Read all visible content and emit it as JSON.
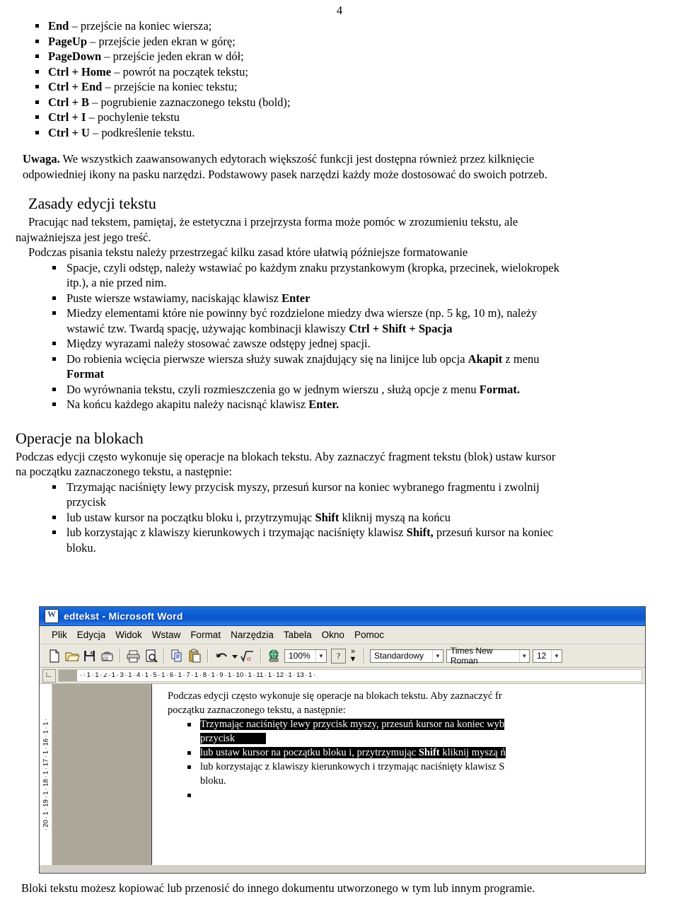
{
  "page": {
    "number": "4"
  },
  "shortcut_list": [
    {
      "key": "End",
      "desc": " – przejście na koniec wiersza;"
    },
    {
      "key": "PageUp",
      "desc": " – przejście jeden ekran w górę;"
    },
    {
      "key": "PageDown",
      "desc": " – przejście jeden ekran w dół;"
    },
    {
      "key": "Ctrl + Home",
      "desc": " – powrót na początek tekstu;"
    },
    {
      "key": "Ctrl + End",
      "desc": " – przejście na koniec tekstu;"
    },
    {
      "key": "Ctrl + B",
      "desc": " – pogrubienie zaznaczonego tekstu (bold);"
    },
    {
      "key": "Ctrl + I",
      "desc": " – pochylenie tekstu"
    },
    {
      "key": "Ctrl + U",
      "desc": " – podkreślenie tekstu."
    }
  ],
  "note": {
    "label": "Uwaga.",
    "line1": " We wszystkich zaawansowanych edytorach większość funkcji jest dostępna również przez kilknięcie",
    "line2": "odpowiedniej ikony na pasku narzędzi. Podstawowy pasek narzędzi każdy może dostosować do swoich potrzeb."
  },
  "section_rules": {
    "heading": "Zasady edycji tekstu",
    "intro_line1": "Pracując nad tekstem, pamiętaj, że estetyczna i przejrzysta forma może pomóc  w zrozumieniu tekstu, ale",
    "intro_line2": "najważniejsza jest jego treść.",
    "lead": "Podczas pisania tekstu należy przestrzegać kilku zasad które ułatwią późniejsze formatowanie",
    "items": [
      {
        "line1": "Spacje, czyli odstęp, należy wstawiać po każdym znaku przystankowym (kropka, przecinek, wielokropek",
        "line2": "itp.), a nie przed nim."
      },
      {
        "pre": "Puste wiersze wstawiamy, naciskając klawisz ",
        "bold": "Enter",
        "post": ""
      },
      {
        "line1": "Miedzy elementami które nie powinny być rozdzielone miedzy dwa wiersze (np. 5 kg, 10 m), należy",
        "line2_pre": "wstawić tzw. Twardą spację, używając kombinacji klawiszy ",
        "line2_bold": "Ctrl + Shift + Spacja"
      },
      {
        "plain": "Między wyrazami należy stosować zawsze odstępy jednej spacji."
      },
      {
        "line1_pre": "Do robienia wcięcia pierwsze wiersza służy suwak znajdujący się na linijce lub opcja ",
        "line1_bold": "Akapit",
        "line1_post": " z menu",
        "line2_bold": "Format"
      },
      {
        "pre": "Do wyrównania tekstu, czyli rozmieszczenia go w jednym wierszu , służą opcje z menu ",
        "bold": "Format."
      },
      {
        "pre": "Na końcu każdego akapitu należy nacisnąć klawisz ",
        "bold": "Enter."
      }
    ]
  },
  "section_blocks": {
    "heading": "Operacje na blokach",
    "intro_line1": "Podczas edycji często wykonuje się operacje na blokach tekstu. Aby zaznaczyć fragment tekstu (blok) ustaw kursor",
    "intro_line2": "na początku zaznaczonego tekstu, a następnie:",
    "items": [
      {
        "line1": "Trzymając naciśnięty lewy przycisk myszy, przesuń kursor na koniec wybranego fragmentu i zwolnij",
        "line2": "przycisk"
      },
      {
        "pre": "lub ustaw kursor na początku bloku i, przytrzymując ",
        "bold": "Shift",
        "post": " kliknij myszą na końcu"
      },
      {
        "line1_pre": "lub korzystając z klawiszy kierunkowych i trzymając naciśnięty klawisz ",
        "line1_bold": "Shift,",
        "line1_post": " przesuń kursor na koniec",
        "line2": "bloku."
      }
    ]
  },
  "word_window": {
    "title": "edtekst - Microsoft Word",
    "app_icon": "word-document-icon",
    "menu": [
      {
        "label": "Plik",
        "accel": "P"
      },
      {
        "label": "Edycja",
        "accel": "E"
      },
      {
        "label": "Widok",
        "accel": "W"
      },
      {
        "label": "Wstaw",
        "accel": "s"
      },
      {
        "label": "Format",
        "accel": "F"
      },
      {
        "label": "Narzędzia",
        "accel": "N"
      },
      {
        "label": "Tabela",
        "accel": "T"
      },
      {
        "label": "Okno",
        "accel": "O"
      },
      {
        "label": "Pomoc",
        "accel": "c"
      }
    ],
    "toolbar": {
      "icons": [
        "new-document-icon",
        "open-folder-icon",
        "save-disk-icon",
        "email-icon",
        "print-icon",
        "print-preview-icon",
        "copy-icon",
        "paste-icon",
        "undo-icon",
        "undo-dropdown-icon",
        "formula-icon",
        "insert-hyperlink-icon"
      ],
      "zoom_value": "100%",
      "help_icon": "help-question-icon",
      "overflow_icon": "toolbar-overflow-chevrons",
      "style_value": "Standardowy",
      "font_value": "Times New Roman",
      "size_value": "12"
    },
    "ruler": {
      "tabstop_icon": "left-tab-stop-icon",
      "horizontal_ticks": "·  · 1 · 1 · 2 · 1 · 3 · 1 · 4 · 1 · 5 · 1 · 6 · 1 · 7 · 1 · 8 · 1 · 9 · 1 · 10 · 1 · 11 · 1 · 12 · 1 · 13 · 1 ·",
      "vertical_ticks": "· 20 · 1 · 19 · 1 · 18 · 1 · 17 · 1 · 16 · 1 · 1 ·",
      "indent_marker_icon": "first-line-indent-marker"
    },
    "document": {
      "line1": "Podczas edycji często wykonuje się operacje na blokach tekstu. Aby zaznaczyć fr",
      "line2": "początku zaznaczonego tekstu, a następnie:",
      "bullet1_line1": "Trzymając naciśnięty lewy przycisk myszy, przesuń kursor na koniec wyb",
      "bullet1_line2": "przycisk",
      "bullet2_pre": "lub ustaw kursor na początku bloku i, przytrzymując ",
      "bullet2_bold": "Shift",
      "bullet2_post": " kliknij myszą ń",
      "bullet3": "lub korzystając z klawiszy kierunkowych i trzymając naciśnięty klawisz S",
      "bullet3_line2": "bloku."
    }
  },
  "caption": "Bloki tekstu możesz kopiować lub przenosić do innego dokumentu utworzonego w tym lub innym programie.",
  "colors": {
    "titlebar_blue": "#0A5BD4",
    "toolbar_bg": "#E9E7DE",
    "grey_block": "#ACA899",
    "selection_bg": "#000000"
  }
}
